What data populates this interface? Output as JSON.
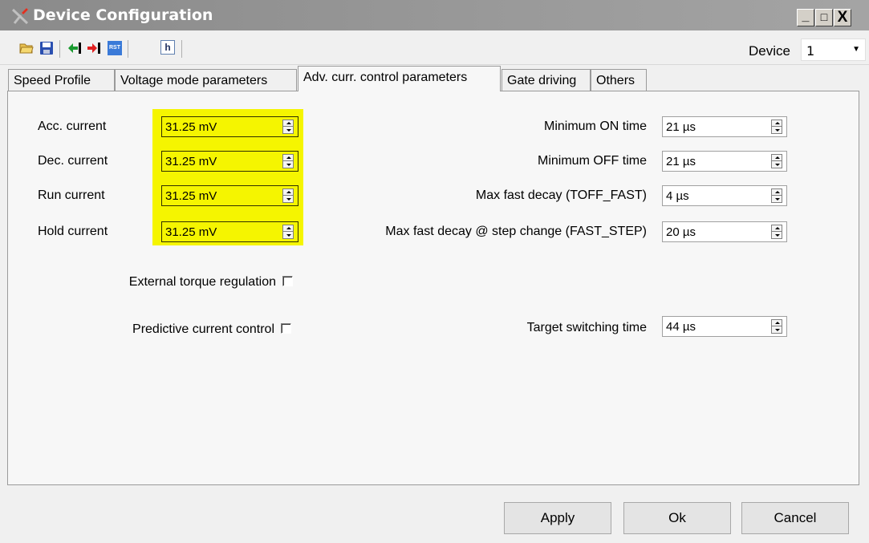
{
  "window": {
    "title": "Device Configuration",
    "controls": [
      "_",
      "□",
      "X"
    ]
  },
  "toolbar": {
    "icons": [
      "open-folder-icon",
      "save-icon",
      "import-icon",
      "export-icon",
      "reset-icon",
      "header-file-icon"
    ],
    "reset_text": "RST",
    "header_text": "h",
    "device_label": "Device",
    "device_value": "1"
  },
  "tabs": [
    {
      "label": "Speed Profile",
      "active": false
    },
    {
      "label": "Voltage mode parameters",
      "active": false
    },
    {
      "label": "Adv. curr. control parameters",
      "active": true
    },
    {
      "label": "Gate driving",
      "active": false
    },
    {
      "label": "Others",
      "active": false
    }
  ],
  "currents": [
    {
      "label": "Acc. current",
      "value": "31.25 mV"
    },
    {
      "label": "Dec. current",
      "value": "31.25 mV"
    },
    {
      "label": "Run current",
      "value": "31.25 mV"
    },
    {
      "label": "Hold current",
      "value": "31.25 mV"
    }
  ],
  "timings": [
    {
      "label": "Minimum ON time",
      "value": "21 µs"
    },
    {
      "label": "Minimum OFF time",
      "value": "21 µs"
    },
    {
      "label": "Max fast decay (TOFF_FAST)",
      "value": "4 µs"
    },
    {
      "label": "Max fast decay @ step change (FAST_STEP)",
      "value": "20 µs"
    }
  ],
  "checkboxes": [
    {
      "label": "External torque regulation",
      "checked": false
    },
    {
      "label": "Predictive current control",
      "checked": false
    }
  ],
  "target_switching": {
    "label": "Target switching time",
    "value": "44 µs"
  },
  "buttons": {
    "apply": "Apply",
    "ok": "Ok",
    "cancel": "Cancel"
  },
  "colors": {
    "highlight": "#f5f500",
    "titlebar": "#8a8a8a"
  }
}
